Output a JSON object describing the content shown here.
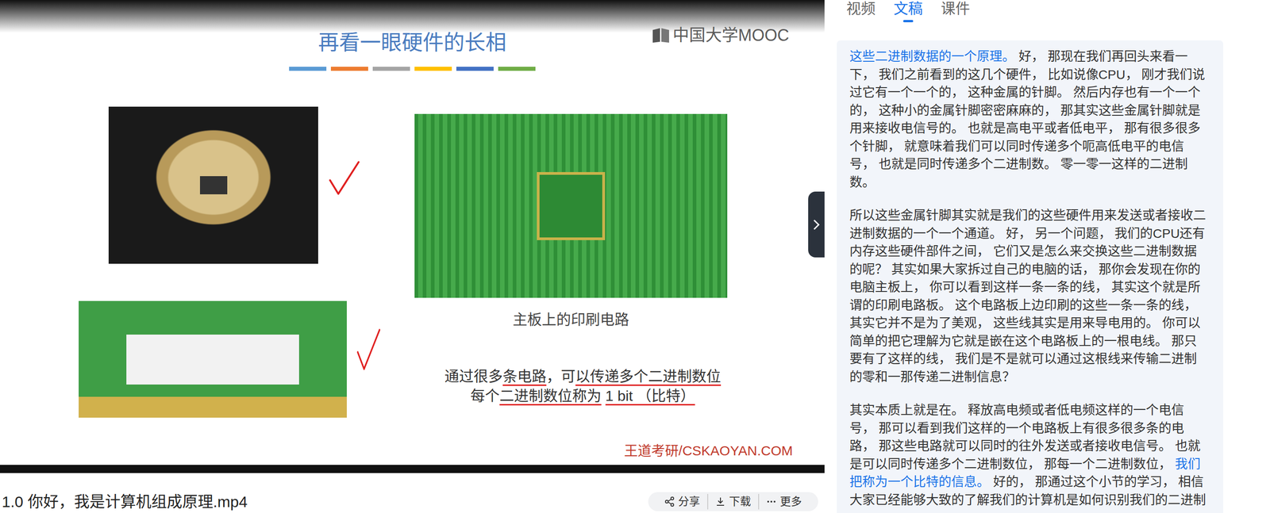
{
  "slide": {
    "title": "再看一眼硬件的长相",
    "title_bars": [
      {
        "color": "#5b9bd5"
      },
      {
        "color": "#ed7d31"
      },
      {
        "color": "#a5a5a5"
      },
      {
        "color": "#ffc000"
      },
      {
        "color": "#4472c4"
      },
      {
        "color": "#70ad47"
      }
    ],
    "logo": "中国大学MOOC",
    "photos": [
      {
        "kind": "cpu",
        "checked": true
      },
      {
        "kind": "pcb",
        "checked": false
      },
      {
        "kind": "ram",
        "checked": true
      }
    ],
    "caption": "主板上的印刷电路",
    "lines": [
      [
        {
          "text": "通过很多",
          "annotated": false
        },
        {
          "text": "条电路",
          "annotated": true
        },
        {
          "text": "，可",
          "annotated": false
        },
        {
          "text": "以传递多个二进制数位",
          "annotated": true
        }
      ],
      [
        {
          "text": "每个",
          "annotated": false
        },
        {
          "text": "二进制数位称为",
          "annotated": true
        },
        {
          "text": " ",
          "annotated": false
        },
        {
          "text": "1 bit （比特）",
          "annotated": true
        }
      ]
    ],
    "footer": "王道考研/CSKAOYAN.COM"
  },
  "video_title": "1.0 你好，我是计算机组成原理.mp4",
  "actions": [
    {
      "label": "分享"
    },
    {
      "label": "下载"
    },
    {
      "label": "更多"
    }
  ],
  "tabs": [
    {
      "label": "视频",
      "selected": false
    },
    {
      "label": "文稿",
      "selected": true
    },
    {
      "label": "课件",
      "selected": false
    }
  ],
  "transcript": [
    {
      "segments": [
        {
          "text": "这些二进制数据的一个原理。",
          "highlighted": true
        },
        {
          "text": " 好， 那现在我们再回头来看一下， 我们之前看到的这几个硬件， 比如说像CPU， 刚才我们说过它有一个一个的， 这种金属的针脚。 然后内存也有一个一个的， 这种小的金属针脚密密麻麻的， 那其实这些金属针脚就是用来接收电信号的。 也就是高电平或者低电平， 那有很多很多个针脚， 就意味着我们可以同时传递多个呃高低电平的电信号， 也就是同时传递多个二进制数。 零一零一这样的二进制数。",
          "highlighted": false
        }
      ]
    },
    {
      "segments": [
        {
          "text": "所以这些金属针脚其实就是我们的这些硬件用来发送或者接收二进制数据的一个一个通道。 好， 另一个问题， 我们的CPU还有内存这些硬件部件之间， 它们又是怎么来交换这些二进制数据的呢？ 其实如果大家拆过自己的电脑的话， 那你会发现在你的电脑主板上， 你可以看到这样一条一条的线， 其实这个就是所谓的印刷电路板。 这个电路板上边印刷的这些一条一条的线， 其实它并不是为了美观， 这些线其实是用来导电用的。 你可以简单的把它理解为它就是嵌在这个电路板上的一根电线。 那只要有了这样的线， 我们是不是就可以通过这根线来传输二进制的零和一那传递二进制信息？",
          "highlighted": false
        }
      ]
    },
    {
      "segments": [
        {
          "text": "其实本质上就是在。 释放高电频或者低电频这样的一个电信号， 那可以看到我们这样的一个电路板上有很多很多条的电路， 那这些电路就可以同时的往外发送或者接收电信号。 也就是可以同时传递多个二进制数位， 那每一个二进制数位， ",
          "highlighted": false
        },
        {
          "text": "我们把称为一个比特的信息。",
          "highlighted": true
        },
        {
          "text": " 好的， 那通过这个小节的学习， 相信大家已经能够大致的了解我们的计算机是如何识别我们的二进制",
          "highlighted": false
        }
      ]
    }
  ]
}
